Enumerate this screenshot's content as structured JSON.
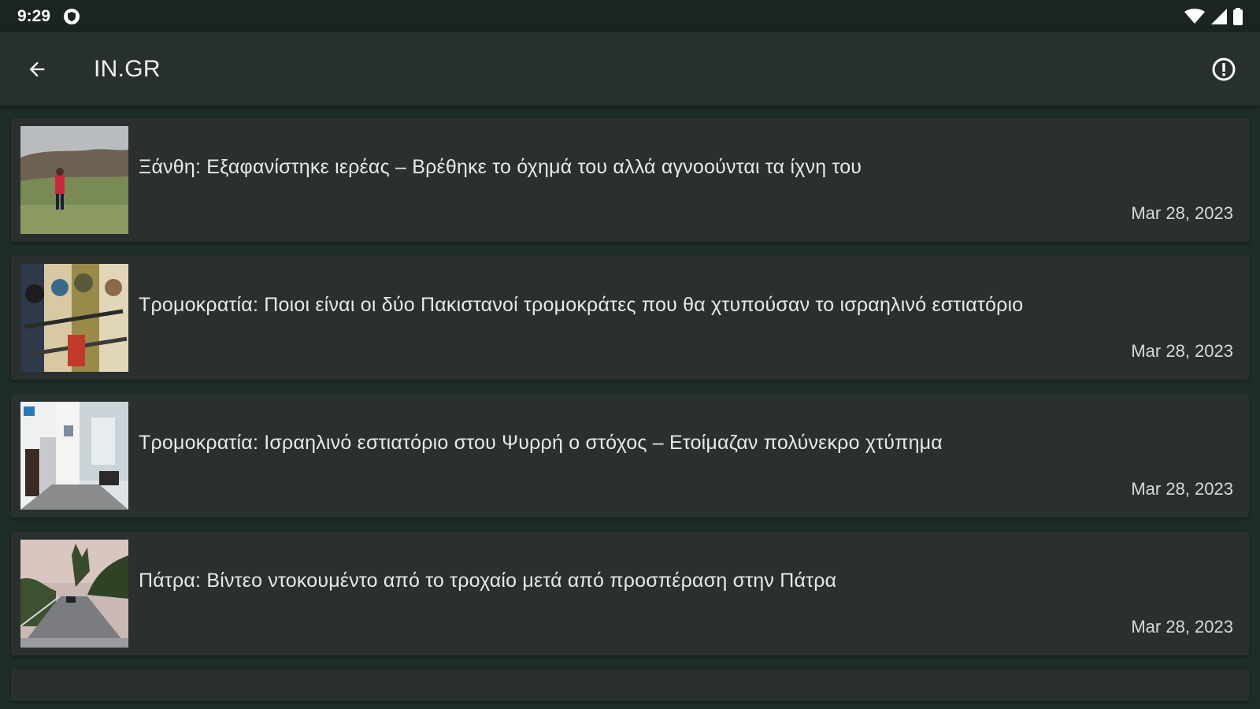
{
  "status_bar": {
    "time": "9:29",
    "notification_icon": "shield-notification-icon",
    "wifi_icon": "wifi-icon",
    "signal_icon": "cell-signal-icon",
    "battery_icon": "battery-icon"
  },
  "app_bar": {
    "back_icon": "arrow-back-icon",
    "title": "IN.GR",
    "info_icon": "info-icon"
  },
  "articles": [
    {
      "title": "Ξάνθη: Εξαφανίστηκε ιερέας – Βρέθηκε το όχημά του αλλά αγνοούνται τα ίχνη του",
      "date": "Mar 28, 2023"
    },
    {
      "title": "Τρομοκρατία: Ποιοι είναι οι δύο Πακιστανοί τρομοκράτες που θα χτυπούσαν το ισραηλινό εστιατόριο",
      "date": "Mar 28, 2023"
    },
    {
      "title": "Τρομοκρατία: Ισραηλινό εστιατόριο στου Ψυρρή ο στόχος – Ετοίμαζαν πολύνεκρο χτύπημα",
      "date": "Mar 28, 2023"
    },
    {
      "title": "Πάτρα: Βίντεο ντοκουμέντο από το τροχαίο μετά από προσπέραση στην Πάτρα",
      "date": "Mar 28, 2023"
    }
  ],
  "colors": {
    "background": "#1f2d2a",
    "app_bar": "#28302e",
    "card": "#2a302f",
    "text": "#e6ebe8"
  }
}
